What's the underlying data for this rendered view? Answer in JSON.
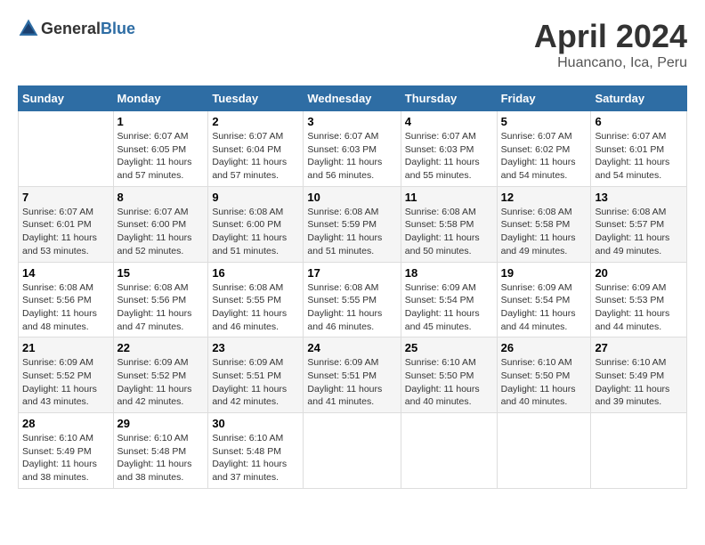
{
  "header": {
    "logo_general": "General",
    "logo_blue": "Blue",
    "month": "April 2024",
    "location": "Huancano, Ica, Peru"
  },
  "weekdays": [
    "Sunday",
    "Monday",
    "Tuesday",
    "Wednesday",
    "Thursday",
    "Friday",
    "Saturday"
  ],
  "weeks": [
    [
      {
        "day": "",
        "info": ""
      },
      {
        "day": "1",
        "info": "Sunrise: 6:07 AM\nSunset: 6:05 PM\nDaylight: 11 hours\nand 57 minutes."
      },
      {
        "day": "2",
        "info": "Sunrise: 6:07 AM\nSunset: 6:04 PM\nDaylight: 11 hours\nand 57 minutes."
      },
      {
        "day": "3",
        "info": "Sunrise: 6:07 AM\nSunset: 6:03 PM\nDaylight: 11 hours\nand 56 minutes."
      },
      {
        "day": "4",
        "info": "Sunrise: 6:07 AM\nSunset: 6:03 PM\nDaylight: 11 hours\nand 55 minutes."
      },
      {
        "day": "5",
        "info": "Sunrise: 6:07 AM\nSunset: 6:02 PM\nDaylight: 11 hours\nand 54 minutes."
      },
      {
        "day": "6",
        "info": "Sunrise: 6:07 AM\nSunset: 6:01 PM\nDaylight: 11 hours\nand 54 minutes."
      }
    ],
    [
      {
        "day": "7",
        "info": "Sunrise: 6:07 AM\nSunset: 6:01 PM\nDaylight: 11 hours\nand 53 minutes."
      },
      {
        "day": "8",
        "info": "Sunrise: 6:07 AM\nSunset: 6:00 PM\nDaylight: 11 hours\nand 52 minutes."
      },
      {
        "day": "9",
        "info": "Sunrise: 6:08 AM\nSunset: 6:00 PM\nDaylight: 11 hours\nand 51 minutes."
      },
      {
        "day": "10",
        "info": "Sunrise: 6:08 AM\nSunset: 5:59 PM\nDaylight: 11 hours\nand 51 minutes."
      },
      {
        "day": "11",
        "info": "Sunrise: 6:08 AM\nSunset: 5:58 PM\nDaylight: 11 hours\nand 50 minutes."
      },
      {
        "day": "12",
        "info": "Sunrise: 6:08 AM\nSunset: 5:58 PM\nDaylight: 11 hours\nand 49 minutes."
      },
      {
        "day": "13",
        "info": "Sunrise: 6:08 AM\nSunset: 5:57 PM\nDaylight: 11 hours\nand 49 minutes."
      }
    ],
    [
      {
        "day": "14",
        "info": "Sunrise: 6:08 AM\nSunset: 5:56 PM\nDaylight: 11 hours\nand 48 minutes."
      },
      {
        "day": "15",
        "info": "Sunrise: 6:08 AM\nSunset: 5:56 PM\nDaylight: 11 hours\nand 47 minutes."
      },
      {
        "day": "16",
        "info": "Sunrise: 6:08 AM\nSunset: 5:55 PM\nDaylight: 11 hours\nand 46 minutes."
      },
      {
        "day": "17",
        "info": "Sunrise: 6:08 AM\nSunset: 5:55 PM\nDaylight: 11 hours\nand 46 minutes."
      },
      {
        "day": "18",
        "info": "Sunrise: 6:09 AM\nSunset: 5:54 PM\nDaylight: 11 hours\nand 45 minutes."
      },
      {
        "day": "19",
        "info": "Sunrise: 6:09 AM\nSunset: 5:54 PM\nDaylight: 11 hours\nand 44 minutes."
      },
      {
        "day": "20",
        "info": "Sunrise: 6:09 AM\nSunset: 5:53 PM\nDaylight: 11 hours\nand 44 minutes."
      }
    ],
    [
      {
        "day": "21",
        "info": "Sunrise: 6:09 AM\nSunset: 5:52 PM\nDaylight: 11 hours\nand 43 minutes."
      },
      {
        "day": "22",
        "info": "Sunrise: 6:09 AM\nSunset: 5:52 PM\nDaylight: 11 hours\nand 42 minutes."
      },
      {
        "day": "23",
        "info": "Sunrise: 6:09 AM\nSunset: 5:51 PM\nDaylight: 11 hours\nand 42 minutes."
      },
      {
        "day": "24",
        "info": "Sunrise: 6:09 AM\nSunset: 5:51 PM\nDaylight: 11 hours\nand 41 minutes."
      },
      {
        "day": "25",
        "info": "Sunrise: 6:10 AM\nSunset: 5:50 PM\nDaylight: 11 hours\nand 40 minutes."
      },
      {
        "day": "26",
        "info": "Sunrise: 6:10 AM\nSunset: 5:50 PM\nDaylight: 11 hours\nand 40 minutes."
      },
      {
        "day": "27",
        "info": "Sunrise: 6:10 AM\nSunset: 5:49 PM\nDaylight: 11 hours\nand 39 minutes."
      }
    ],
    [
      {
        "day": "28",
        "info": "Sunrise: 6:10 AM\nSunset: 5:49 PM\nDaylight: 11 hours\nand 38 minutes."
      },
      {
        "day": "29",
        "info": "Sunrise: 6:10 AM\nSunset: 5:48 PM\nDaylight: 11 hours\nand 38 minutes."
      },
      {
        "day": "30",
        "info": "Sunrise: 6:10 AM\nSunset: 5:48 PM\nDaylight: 11 hours\nand 37 minutes."
      },
      {
        "day": "",
        "info": ""
      },
      {
        "day": "",
        "info": ""
      },
      {
        "day": "",
        "info": ""
      },
      {
        "day": "",
        "info": ""
      }
    ]
  ]
}
